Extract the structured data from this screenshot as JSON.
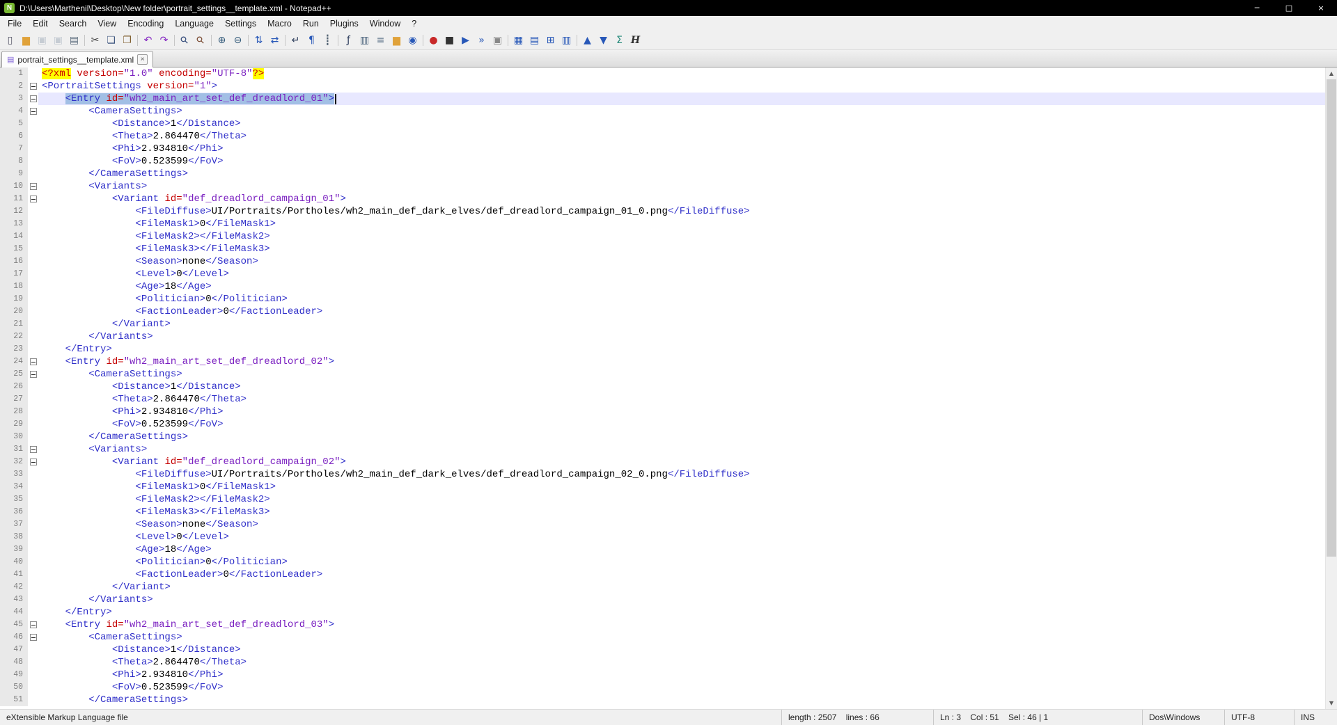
{
  "window": {
    "title": "D:\\Users\\Marthenil\\Desktop\\New folder\\portrait_settings__template.xml - Notepad++",
    "app_icon_glyph": "N",
    "controls": {
      "minimize": "─",
      "restore": "□",
      "close": "×"
    }
  },
  "menu": {
    "items": [
      "File",
      "Edit",
      "Search",
      "View",
      "Encoding",
      "Language",
      "Settings",
      "Macro",
      "Run",
      "Plugins",
      "Window",
      "?"
    ]
  },
  "toolbar": {
    "groups": [
      [
        {
          "n": "new-file",
          "g": "▯",
          "c": "#556"
        },
        {
          "n": "open-folder",
          "g": "▆",
          "c": "#e0a23a"
        },
        {
          "n": "save-file",
          "g": "▣",
          "c": "#7a8aa0",
          "d": 1
        },
        {
          "n": "save-all",
          "g": "▣",
          "c": "#7a8aa0",
          "d": 1
        },
        {
          "n": "print",
          "g": "▤",
          "c": "#607080"
        }
      ],
      [
        {
          "n": "cut",
          "g": "✂",
          "c": "#404040"
        },
        {
          "n": "copy",
          "g": "❏",
          "c": "#405880"
        },
        {
          "n": "paste",
          "g": "❐",
          "c": "#806030"
        }
      ],
      [
        {
          "n": "undo",
          "g": "↶",
          "c": "#8020c0"
        },
        {
          "n": "redo",
          "g": "↷",
          "c": "#8020c0"
        }
      ],
      [
        {
          "n": "find",
          "g": "⚲",
          "c": "#304878",
          "r": 1
        },
        {
          "n": "replace",
          "g": "⚲",
          "c": "#784830",
          "r": 1
        }
      ],
      [
        {
          "n": "zoom-in",
          "g": "⊕",
          "c": "#305878"
        },
        {
          "n": "zoom-out",
          "g": "⊖",
          "c": "#305878"
        }
      ],
      [
        {
          "n": "sync-vertical-scroll",
          "g": "⇅",
          "c": "#2858b8"
        },
        {
          "n": "sync-horizontal-scroll",
          "g": "⇄",
          "c": "#2858b8"
        }
      ],
      [
        {
          "n": "word-wrap",
          "g": "↵",
          "c": "#283858"
        },
        {
          "n": "show-all-characters",
          "g": "¶",
          "c": "#2858b8"
        },
        {
          "n": "indent-guide",
          "g": "┋",
          "c": "#506070"
        }
      ],
      [
        {
          "n": "function-list",
          "g": "ƒ",
          "c": "#283858"
        },
        {
          "n": "document-map",
          "g": "▥",
          "c": "#506880"
        },
        {
          "n": "document-list",
          "g": "≡",
          "c": "#506880"
        },
        {
          "n": "folder-as-workspace",
          "g": "▆",
          "c": "#e0a23a"
        },
        {
          "n": "monitoring",
          "g": "◉",
          "c": "#2858b8"
        }
      ],
      [
        {
          "n": "macro-record",
          "g": "●",
          "c": "#c82828"
        },
        {
          "n": "macro-stop",
          "g": "■",
          "c": "#333333"
        },
        {
          "n": "macro-playback",
          "g": "▶",
          "c": "#2858b8"
        },
        {
          "n": "macro-run-multiple",
          "g": "»",
          "c": "#2858b8"
        },
        {
          "n": "macro-save",
          "g": "▣",
          "c": "#888888"
        }
      ],
      [
        {
          "n": "plugin-table-view",
          "g": "▦",
          "c": "#2858b8"
        },
        {
          "n": "plugin-column-tool",
          "g": "▤",
          "c": "#2858b8"
        },
        {
          "n": "plugin-grid",
          "g": "⊞",
          "c": "#2858b8"
        },
        {
          "n": "plugin-panel",
          "g": "▥",
          "c": "#2858b8"
        }
      ],
      [
        {
          "n": "sort-ascending",
          "g": "▲",
          "c": "#2858b8"
        },
        {
          "n": "sort-descending",
          "g": "▼",
          "c": "#2858b8"
        },
        {
          "n": "summation",
          "g": "Σ",
          "c": "#208878"
        },
        {
          "n": "html-preview",
          "g": "H",
          "c": "#303030",
          "it": 1
        }
      ]
    ]
  },
  "tabs": [
    {
      "label": "portrait_settings__template.xml",
      "active": true
    }
  ],
  "tab_ui": {
    "doc_icon_glyph": "▤",
    "close_glyph": "×"
  },
  "editor": {
    "scrollbar": {
      "up_glyph": "▲",
      "down_glyph": "▼"
    },
    "lines": [
      {
        "n": 1,
        "i": 0,
        "t": [
          [
            "d",
            "<?xml"
          ],
          [
            "p",
            " "
          ],
          [
            "a",
            "version="
          ],
          [
            "v",
            "\"1.0\""
          ],
          [
            "p",
            " "
          ],
          [
            "a",
            "encoding="
          ],
          [
            "v",
            "\"UTF-8\""
          ],
          [
            "d",
            "?>"
          ]
        ]
      },
      {
        "n": 2,
        "i": 0,
        "f": 1,
        "t": [
          [
            "t",
            "<PortraitSettings"
          ],
          [
            "p",
            " "
          ],
          [
            "a",
            "version="
          ],
          [
            "v",
            "\"1\""
          ],
          [
            "t",
            ">"
          ]
        ]
      },
      {
        "n": 3,
        "i": 4,
        "f": 1,
        "sel": 1,
        "caret": 1,
        "cl": 1,
        "t": [
          [
            "t",
            "<Entry"
          ],
          [
            "p",
            " "
          ],
          [
            "a",
            "id="
          ],
          [
            "v",
            "\"wh2_main_art_set_def_dreadlord_01\""
          ],
          [
            "t",
            ">"
          ]
        ]
      },
      {
        "n": 4,
        "i": 8,
        "f": 1,
        "t": [
          [
            "t",
            "<CameraSettings>"
          ]
        ]
      },
      {
        "n": 5,
        "i": 12,
        "t": [
          [
            "t",
            "<Distance>"
          ],
          [
            "x",
            "1"
          ],
          [
            "t",
            "</Distance>"
          ]
        ]
      },
      {
        "n": 6,
        "i": 12,
        "t": [
          [
            "t",
            "<Theta>"
          ],
          [
            "x",
            "2.864470"
          ],
          [
            "t",
            "</Theta>"
          ]
        ]
      },
      {
        "n": 7,
        "i": 12,
        "t": [
          [
            "t",
            "<Phi>"
          ],
          [
            "x",
            "2.934810"
          ],
          [
            "t",
            "</Phi>"
          ]
        ]
      },
      {
        "n": 8,
        "i": 12,
        "t": [
          [
            "t",
            "<FoV>"
          ],
          [
            "x",
            "0.523599"
          ],
          [
            "t",
            "</FoV>"
          ]
        ]
      },
      {
        "n": 9,
        "i": 8,
        "t": [
          [
            "t",
            "</CameraSettings>"
          ]
        ]
      },
      {
        "n": 10,
        "i": 8,
        "f": 1,
        "t": [
          [
            "t",
            "<Variants>"
          ]
        ]
      },
      {
        "n": 11,
        "i": 12,
        "f": 1,
        "t": [
          [
            "t",
            "<Variant"
          ],
          [
            "p",
            " "
          ],
          [
            "a",
            "id="
          ],
          [
            "v",
            "\"def_dreadlord_campaign_01\""
          ],
          [
            "t",
            ">"
          ]
        ]
      },
      {
        "n": 12,
        "i": 16,
        "t": [
          [
            "t",
            "<FileDiffuse>"
          ],
          [
            "x",
            "UI/Portraits/Portholes/wh2_main_def_dark_elves/def_dreadlord_campaign_01_0.png"
          ],
          [
            "t",
            "</FileDiffuse>"
          ]
        ]
      },
      {
        "n": 13,
        "i": 16,
        "t": [
          [
            "t",
            "<FileMask1>"
          ],
          [
            "x",
            "0"
          ],
          [
            "t",
            "</FileMask1>"
          ]
        ]
      },
      {
        "n": 14,
        "i": 16,
        "t": [
          [
            "t",
            "<FileMask2>"
          ],
          [
            "t",
            "</FileMask2>"
          ]
        ]
      },
      {
        "n": 15,
        "i": 16,
        "t": [
          [
            "t",
            "<FileMask3>"
          ],
          [
            "t",
            "</FileMask3>"
          ]
        ]
      },
      {
        "n": 16,
        "i": 16,
        "t": [
          [
            "t",
            "<Season>"
          ],
          [
            "x",
            "none"
          ],
          [
            "t",
            "</Season>"
          ]
        ]
      },
      {
        "n": 17,
        "i": 16,
        "t": [
          [
            "t",
            "<Level>"
          ],
          [
            "x",
            "0"
          ],
          [
            "t",
            "</Level>"
          ]
        ]
      },
      {
        "n": 18,
        "i": 16,
        "t": [
          [
            "t",
            "<Age>"
          ],
          [
            "x",
            "18"
          ],
          [
            "t",
            "</Age>"
          ]
        ]
      },
      {
        "n": 19,
        "i": 16,
        "t": [
          [
            "t",
            "<Politician>"
          ],
          [
            "x",
            "0"
          ],
          [
            "t",
            "</Politician>"
          ]
        ]
      },
      {
        "n": 20,
        "i": 16,
        "t": [
          [
            "t",
            "<FactionLeader>"
          ],
          [
            "x",
            "0"
          ],
          [
            "t",
            "</FactionLeader>"
          ]
        ]
      },
      {
        "n": 21,
        "i": 12,
        "t": [
          [
            "t",
            "</Variant>"
          ]
        ]
      },
      {
        "n": 22,
        "i": 8,
        "t": [
          [
            "t",
            "</Variants>"
          ]
        ]
      },
      {
        "n": 23,
        "i": 4,
        "t": [
          [
            "t",
            "</Entry>"
          ]
        ]
      },
      {
        "n": 24,
        "i": 4,
        "f": 1,
        "t": [
          [
            "t",
            "<Entry"
          ],
          [
            "p",
            " "
          ],
          [
            "a",
            "id="
          ],
          [
            "v",
            "\"wh2_main_art_set_def_dreadlord_02\""
          ],
          [
            "t",
            ">"
          ]
        ]
      },
      {
        "n": 25,
        "i": 8,
        "f": 1,
        "t": [
          [
            "t",
            "<CameraSettings>"
          ]
        ]
      },
      {
        "n": 26,
        "i": 12,
        "t": [
          [
            "t",
            "<Distance>"
          ],
          [
            "x",
            "1"
          ],
          [
            "t",
            "</Distance>"
          ]
        ]
      },
      {
        "n": 27,
        "i": 12,
        "t": [
          [
            "t",
            "<Theta>"
          ],
          [
            "x",
            "2.864470"
          ],
          [
            "t",
            "</Theta>"
          ]
        ]
      },
      {
        "n": 28,
        "i": 12,
        "t": [
          [
            "t",
            "<Phi>"
          ],
          [
            "x",
            "2.934810"
          ],
          [
            "t",
            "</Phi>"
          ]
        ]
      },
      {
        "n": 29,
        "i": 12,
        "t": [
          [
            "t",
            "<FoV>"
          ],
          [
            "x",
            "0.523599"
          ],
          [
            "t",
            "</FoV>"
          ]
        ]
      },
      {
        "n": 30,
        "i": 8,
        "t": [
          [
            "t",
            "</CameraSettings>"
          ]
        ]
      },
      {
        "n": 31,
        "i": 8,
        "f": 1,
        "t": [
          [
            "t",
            "<Variants>"
          ]
        ]
      },
      {
        "n": 32,
        "i": 12,
        "f": 1,
        "t": [
          [
            "t",
            "<Variant"
          ],
          [
            "p",
            " "
          ],
          [
            "a",
            "id="
          ],
          [
            "v",
            "\"def_dreadlord_campaign_02\""
          ],
          [
            "t",
            ">"
          ]
        ]
      },
      {
        "n": 33,
        "i": 16,
        "t": [
          [
            "t",
            "<FileDiffuse>"
          ],
          [
            "x",
            "UI/Portraits/Portholes/wh2_main_def_dark_elves/def_dreadlord_campaign_02_0.png"
          ],
          [
            "t",
            "</FileDiffuse>"
          ]
        ]
      },
      {
        "n": 34,
        "i": 16,
        "t": [
          [
            "t",
            "<FileMask1>"
          ],
          [
            "x",
            "0"
          ],
          [
            "t",
            "</FileMask1>"
          ]
        ]
      },
      {
        "n": 35,
        "i": 16,
        "t": [
          [
            "t",
            "<FileMask2>"
          ],
          [
            "t",
            "</FileMask2>"
          ]
        ]
      },
      {
        "n": 36,
        "i": 16,
        "t": [
          [
            "t",
            "<FileMask3>"
          ],
          [
            "t",
            "</FileMask3>"
          ]
        ]
      },
      {
        "n": 37,
        "i": 16,
        "t": [
          [
            "t",
            "<Season>"
          ],
          [
            "x",
            "none"
          ],
          [
            "t",
            "</Season>"
          ]
        ]
      },
      {
        "n": 38,
        "i": 16,
        "t": [
          [
            "t",
            "<Level>"
          ],
          [
            "x",
            "0"
          ],
          [
            "t",
            "</Level>"
          ]
        ]
      },
      {
        "n": 39,
        "i": 16,
        "t": [
          [
            "t",
            "<Age>"
          ],
          [
            "x",
            "18"
          ],
          [
            "t",
            "</Age>"
          ]
        ]
      },
      {
        "n": 40,
        "i": 16,
        "t": [
          [
            "t",
            "<Politician>"
          ],
          [
            "x",
            "0"
          ],
          [
            "t",
            "</Politician>"
          ]
        ]
      },
      {
        "n": 41,
        "i": 16,
        "t": [
          [
            "t",
            "<FactionLeader>"
          ],
          [
            "x",
            "0"
          ],
          [
            "t",
            "</FactionLeader>"
          ]
        ]
      },
      {
        "n": 42,
        "i": 12,
        "t": [
          [
            "t",
            "</Variant>"
          ]
        ]
      },
      {
        "n": 43,
        "i": 8,
        "t": [
          [
            "t",
            "</Variants>"
          ]
        ]
      },
      {
        "n": 44,
        "i": 4,
        "t": [
          [
            "t",
            "</Entry>"
          ]
        ]
      },
      {
        "n": 45,
        "i": 4,
        "f": 1,
        "t": [
          [
            "t",
            "<Entry"
          ],
          [
            "p",
            " "
          ],
          [
            "a",
            "id="
          ],
          [
            "v",
            "\"wh2_main_art_set_def_dreadlord_03\""
          ],
          [
            "t",
            ">"
          ]
        ]
      },
      {
        "n": 46,
        "i": 8,
        "f": 1,
        "t": [
          [
            "t",
            "<CameraSettings>"
          ]
        ]
      },
      {
        "n": 47,
        "i": 12,
        "t": [
          [
            "t",
            "<Distance>"
          ],
          [
            "x",
            "1"
          ],
          [
            "t",
            "</Distance>"
          ]
        ]
      },
      {
        "n": 48,
        "i": 12,
        "t": [
          [
            "t",
            "<Theta>"
          ],
          [
            "x",
            "2.864470"
          ],
          [
            "t",
            "</Theta>"
          ]
        ]
      },
      {
        "n": 49,
        "i": 12,
        "t": [
          [
            "t",
            "<Phi>"
          ],
          [
            "x",
            "2.934810"
          ],
          [
            "t",
            "</Phi>"
          ]
        ]
      },
      {
        "n": 50,
        "i": 12,
        "t": [
          [
            "t",
            "<FoV>"
          ],
          [
            "x",
            "0.523599"
          ],
          [
            "t",
            "</FoV>"
          ]
        ]
      },
      {
        "n": 51,
        "i": 8,
        "t": [
          [
            "t",
            "</CameraSettings>"
          ]
        ]
      }
    ]
  },
  "status_bar": {
    "doc_type": "eXtensible Markup Language file",
    "length_lines": "length : 2507    lines : 66",
    "cursor": "Ln : 3    Col : 51    Sel : 46 | 1",
    "eol": "Dos\\Windows",
    "encoding": "UTF-8",
    "ins": "INS"
  },
  "colors": {
    "titlebar_bg": "#000000",
    "chrome_bg": "#f0f0f0",
    "tag_fg": "#2f2fc9",
    "attr_fg": "#c40000",
    "value_fg": "#7a1fc0",
    "decl_fg": "#cc0000",
    "decl_bg": "#ffff00",
    "text": "#000000",
    "caret_line_bg": "#e8e8ff",
    "selection_bg": "#a2bfe5",
    "margin_bg": "#e9e9e9",
    "margin_fg": "#808080"
  }
}
